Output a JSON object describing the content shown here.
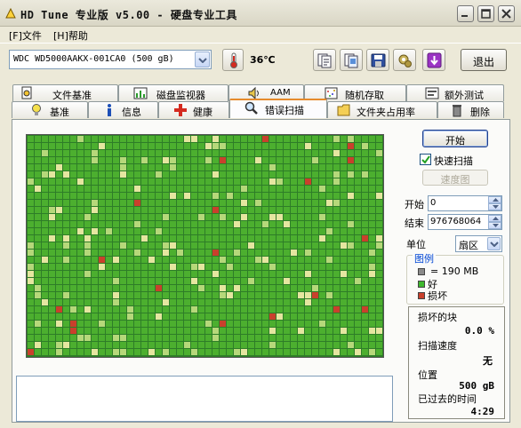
{
  "window": {
    "title": "HD Tune 专业版 v5.00 - 硬盘专业工具"
  },
  "menu": {
    "items": [
      "[F]文件",
      "[H]帮助"
    ]
  },
  "toolbar": {
    "drive": "WDC WD5000AAKX-001CA0 (500 gB)",
    "temperature": "36℃",
    "exit_label": "退出",
    "icons": [
      "copy-text-icon",
      "copy-screenshot-icon",
      "save-icon",
      "options-icon",
      "download-icon"
    ]
  },
  "tabs": {
    "top_row": [
      {
        "label": "文件基准",
        "icon": "file-benchmark-icon"
      },
      {
        "label": "磁盘监视器",
        "icon": "disk-monitor-icon"
      },
      {
        "label": "AAM",
        "icon": "speaker-icon"
      },
      {
        "label": "随机存取",
        "icon": "random-access-icon"
      },
      {
        "label": "额外测试",
        "icon": "extra-tests-icon"
      }
    ],
    "bottom_row": [
      {
        "label": "基准",
        "icon": "benchmark-icon"
      },
      {
        "label": "信息",
        "icon": "info-icon"
      },
      {
        "label": "健康",
        "icon": "health-icon"
      },
      {
        "label": "错误扫描",
        "icon": "magnifier-icon",
        "active": true
      },
      {
        "label": "文件夹占用率",
        "icon": "folder-icon"
      },
      {
        "label": "删除",
        "icon": "trash-icon"
      }
    ]
  },
  "scan": {
    "start_button": "开始",
    "quick_scan_label": "快速扫描",
    "quick_scan_checked": true,
    "speed_map_button": "速度图",
    "start_label": "开始",
    "start_value": "0",
    "end_label": "结束",
    "end_value": "976768064",
    "unit_label": "单位",
    "unit_value": "扇区"
  },
  "legend": {
    "title": "图例",
    "block_size": "= 190 MB",
    "good_label": "好",
    "bad_label": "损坏"
  },
  "stats": {
    "damaged_blocks_label": "损坏的块",
    "damaged_blocks_value": "0.0 %",
    "scan_speed_label": "扫描速度",
    "scan_speed_value": "无",
    "position_label": "位置",
    "position_value": "500 gB",
    "elapsed_label": "已过去的时间",
    "elapsed_value": "4:29"
  },
  "colors": {
    "good": "#4caf2f",
    "good_light": "#b6d87a",
    "good_pale": "#e5e6a0",
    "bad": "#c9402c",
    "grid_line": "#2e7d28",
    "accent_tab": "#e68b2c"
  }
}
